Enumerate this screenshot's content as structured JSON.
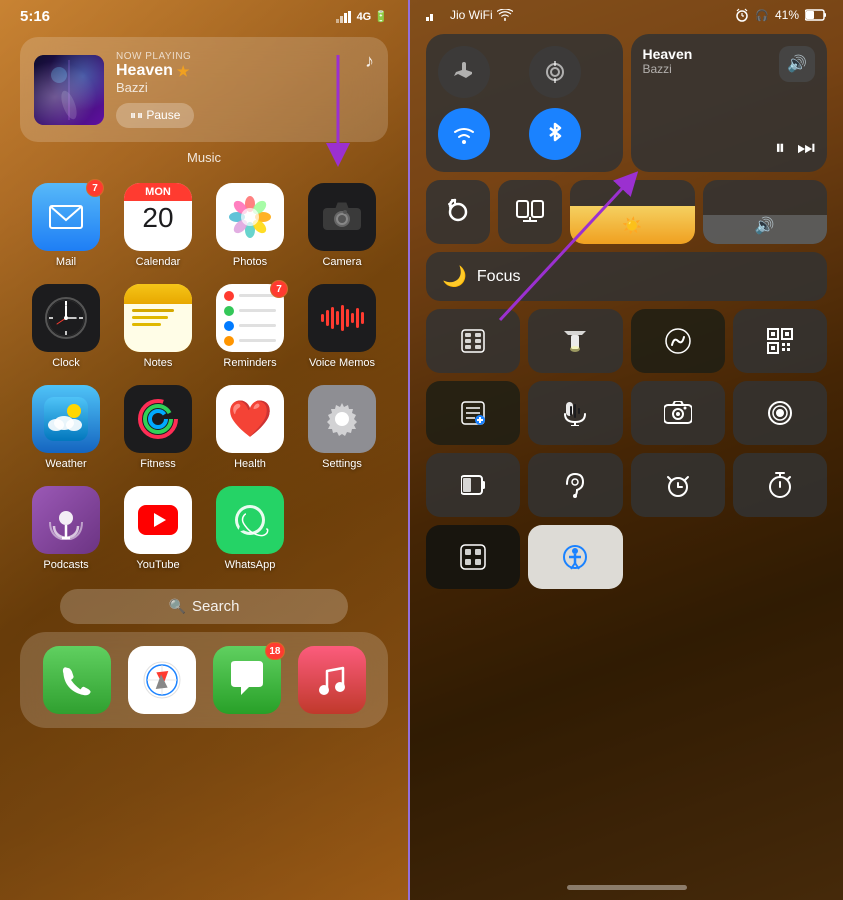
{
  "left": {
    "statusBar": {
      "time": "5:16",
      "icons": "📶 4G"
    },
    "nowPlaying": {
      "label": "NOW PLAYING",
      "title": "Heaven",
      "star": "★",
      "artist": "Bazzi",
      "pauseButton": "⏸ Pause",
      "widgetLabel": "Music"
    },
    "apps": [
      {
        "id": "mail",
        "label": "Mail",
        "badge": "7",
        "icon": "✉️"
      },
      {
        "id": "calendar",
        "label": "Calendar",
        "weekday": "MON",
        "day": "20"
      },
      {
        "id": "photos",
        "label": "Photos"
      },
      {
        "id": "camera",
        "label": "Camera",
        "icon": "📷"
      },
      {
        "id": "clock",
        "label": "Clock"
      },
      {
        "id": "notes",
        "label": "Notes"
      },
      {
        "id": "reminders",
        "label": "Reminders",
        "badge": "7"
      },
      {
        "id": "voicememos",
        "label": "Voice Memos"
      },
      {
        "id": "weather",
        "label": "Weather"
      },
      {
        "id": "fitness",
        "label": "Fitness"
      },
      {
        "id": "health",
        "label": "Health"
      },
      {
        "id": "settings",
        "label": "Settings"
      },
      {
        "id": "podcasts",
        "label": "Podcasts"
      },
      {
        "id": "youtube",
        "label": "YouTube"
      },
      {
        "id": "whatsapp",
        "label": "WhatsApp"
      },
      {
        "id": "placeholder",
        "label": ""
      }
    ],
    "searchBar": {
      "icon": "🔍",
      "label": "Search"
    },
    "dock": [
      {
        "id": "phone",
        "label": "Phone"
      },
      {
        "id": "safari",
        "label": "Safari"
      },
      {
        "id": "messages",
        "label": "Messages",
        "badge": "18"
      },
      {
        "id": "music",
        "label": "Music"
      }
    ]
  },
  "right": {
    "statusBar": {
      "signal": "●● Jio WiFi",
      "wifi": "WiFi",
      "time": "🔒 🎧 41%"
    },
    "controlCenter": {
      "connectivity": {
        "airplane": "✈",
        "cellular": "📡",
        "wifi": "WiFi",
        "bluetooth": "Bluetooth"
      },
      "nowPlaying": {
        "title": "Heaven",
        "artist": "Bazzi",
        "bluetoothIcon": "🔊"
      },
      "focusLabel": "Focus",
      "rows": {
        "grid1": [
          "🧮",
          "🔦",
          "🎵",
          "▦"
        ],
        "grid2": [
          "📋",
          "🎤",
          "📷",
          "⏺"
        ],
        "grid3": [
          "☐",
          "👂",
          "⏰",
          "⏱"
        ],
        "grid4": [
          "▤",
          "♿"
        ]
      }
    },
    "homeIndicator": true
  }
}
